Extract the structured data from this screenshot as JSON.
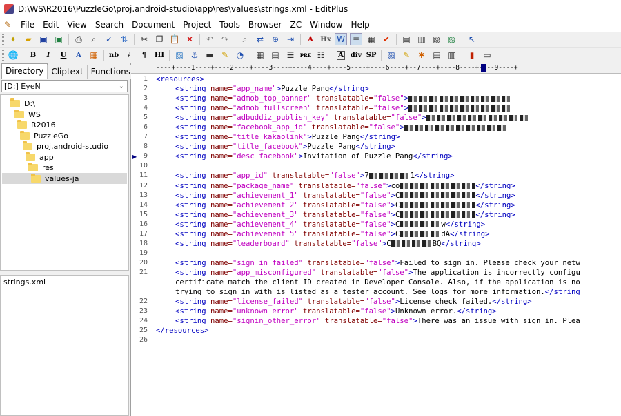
{
  "window": {
    "title": "D:\\WS\\R2016\\PuzzleGo\\proj.android-studio\\app\\res\\values\\strings.xml - EditPlus"
  },
  "menu": {
    "items": [
      "File",
      "Edit",
      "View",
      "Search",
      "Document",
      "Project",
      "Tools",
      "Browser",
      "ZC",
      "Window",
      "Help"
    ]
  },
  "toolbar1": {
    "icons": [
      "new-file-icon",
      "open-icon",
      "save-icon",
      "save-all-icon",
      "print-icon",
      "print-preview-icon",
      "spell-check-icon",
      "ftp-icon",
      "cut-icon",
      "copy-icon",
      "paste-icon",
      "delete-icon",
      "undo-icon",
      "redo-icon",
      "find-icon",
      "replace-icon",
      "find-in-files-icon",
      "goto-icon",
      "font-icon",
      "hx-icon",
      "word-wrap-icon",
      "line-number-icon",
      "column-icon",
      "check-icon",
      "window-list-icon",
      "output-icon",
      "cliptext-icon",
      "browser-icon",
      "context-help-icon"
    ],
    "hx_label": "Hx"
  },
  "toolbar2": {
    "icons": [
      "browser-globe-icon",
      "bold-icon",
      "italic-icon",
      "underline-icon",
      "font-color-icon",
      "color-picker-icon",
      "nbsp-icon",
      "break-icon",
      "paragraph-icon",
      "heading-icon",
      "image-icon",
      "anchor-icon",
      "hr-icon",
      "comment-icon",
      "style-icon",
      "table-icon",
      "list-icon",
      "center-icon",
      "pre-icon",
      "bullet-list-icon",
      "text-block-icon",
      "div-icon",
      "span-icon",
      "form-icon",
      "script-icon",
      "css-icon",
      "preview-icon",
      "validate-icon",
      "toolbar-options-icon"
    ],
    "labels": {
      "bold": "B",
      "italic": "I",
      "underline": "U",
      "font": "A",
      "nb": "nb",
      "br": "↲",
      "para": "¶",
      "hi": "HI",
      "pre": "PRE",
      "div": "div",
      "sp": "SP"
    }
  },
  "sidebar": {
    "tabs": [
      "Directory",
      "Cliptext",
      "Functions"
    ],
    "drive": "[D:] EyeN",
    "tree": [
      {
        "label": "D:\\",
        "depth": 0
      },
      {
        "label": "WS",
        "depth": 1
      },
      {
        "label": "R2016",
        "depth": 2
      },
      {
        "label": "PuzzleGo",
        "depth": 3
      },
      {
        "label": "proj.android-studio",
        "depth": 4
      },
      {
        "label": "app",
        "depth": 5
      },
      {
        "label": "res",
        "depth": 6
      },
      {
        "label": "values-ja",
        "depth": 7,
        "selected": true
      }
    ],
    "files": [
      "strings.xml"
    ]
  },
  "editor": {
    "ruler": "----+----1----+----2----+----3----+----4----+----5----+----6----+--7----+----8----+----9----+",
    "lines": [
      {
        "n": "1",
        "tag_open": "<resources>"
      },
      {
        "n": "2",
        "name": "app_name",
        "text": "Puzzle Pang"
      },
      {
        "n": "3",
        "name": "admob_top_banner",
        "translatable": "false"
      },
      {
        "n": "4",
        "name": "admob_fullscreen",
        "translatable": "false"
      },
      {
        "n": "5",
        "name": "adbuddiz_publish_key",
        "translatable": "false"
      },
      {
        "n": "6",
        "name": "facebook_app_id",
        "translatable": "false"
      },
      {
        "n": "7",
        "name": "title_kakaolink",
        "text": "Puzzle Pang"
      },
      {
        "n": "8",
        "name": "title_facebook",
        "text": "Puzzle Pang"
      },
      {
        "n": "9",
        "name": "desc_facebook",
        "text": "Invitation of Puzzle Pang"
      },
      {
        "n": "10"
      },
      {
        "n": "11",
        "name": "app_id",
        "translatable": "false",
        "text": "7",
        "tail": "1"
      },
      {
        "n": "12",
        "name": "package_name",
        "translatable": "false",
        "text": "co"
      },
      {
        "n": "13",
        "name": "achievement_1",
        "translatable": "false",
        "text": "C"
      },
      {
        "n": "14",
        "name": "achievement_2",
        "translatable": "false",
        "text": "C"
      },
      {
        "n": "15",
        "name": "achievement_3",
        "translatable": "false",
        "text": "C"
      },
      {
        "n": "16",
        "name": "achievement_4",
        "translatable": "false",
        "text": "C",
        "tail": "w"
      },
      {
        "n": "17",
        "name": "achievement_5",
        "translatable": "false",
        "text": "C",
        "tail": "dA"
      },
      {
        "n": "18",
        "name": "leaderboard",
        "translatable": "false",
        "text": "C",
        "tail": "BQ"
      },
      {
        "n": "19"
      },
      {
        "n": "20",
        "name": "sign_in_failed",
        "translatable": "false",
        "text": "Failed to sign in. Please check your netw"
      },
      {
        "n": "21",
        "name": "app_misconfigured",
        "translatable": "false",
        "text": "The application is incorrectly configu"
      },
      {
        "n": "",
        "cont": "certificate match the client ID created in Developer Console. Also, if the application is no"
      },
      {
        "n": "",
        "cont": "trying to sign in with is listed as a tester account. See logs for more information.",
        "cont_tag": "</string"
      },
      {
        "n": "22",
        "name": "license_failed",
        "translatable": "false",
        "text": "License check failed."
      },
      {
        "n": "23",
        "name": "unknown_error",
        "translatable": "false",
        "text": "Unknown error."
      },
      {
        "n": "24",
        "name": "signin_other_error",
        "translatable": "false",
        "text": "There was an issue with sign in. Plea"
      },
      {
        "n": "25",
        "tag_close": "</resources>"
      },
      {
        "n": "26"
      }
    ]
  }
}
